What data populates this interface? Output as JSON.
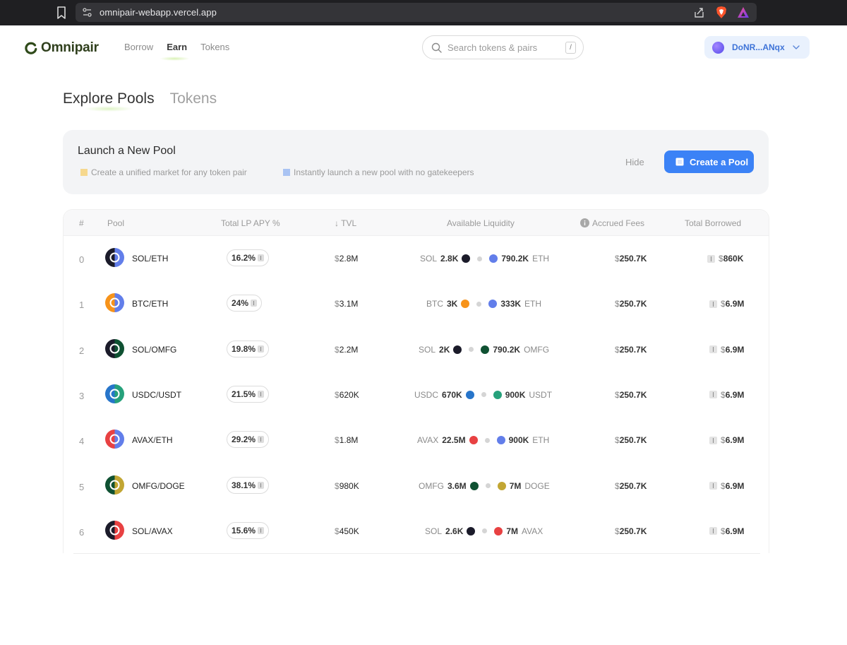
{
  "browser": {
    "url": "omnipair-webapp.vercel.app"
  },
  "header": {
    "logo_text": "Omnipair",
    "nav": [
      {
        "label": "Borrow",
        "active": false
      },
      {
        "label": "Earn",
        "active": true
      },
      {
        "label": "Tokens",
        "active": false
      }
    ],
    "search": {
      "placeholder": "Search tokens & pairs",
      "shortcut": "/"
    },
    "wallet": {
      "label": "DoNR...ANqx"
    }
  },
  "page_tabs": [
    {
      "label": "Explore Pools",
      "active": true
    },
    {
      "label": "Tokens",
      "active": false
    }
  ],
  "launch_card": {
    "title": "Launch a New Pool",
    "features": [
      {
        "text": "Create a unified market for any token pair",
        "color": "#f6d88e"
      },
      {
        "text": "Instantly launch a new pool with no gatekeepers",
        "color": "#a9c3f3"
      }
    ],
    "hide_label": "Hide",
    "create_label": "Create a Pool",
    "accent": "#3b82f6"
  },
  "table": {
    "headers": {
      "index": "#",
      "pool": "Pool",
      "apy": "Total LP APY %",
      "tvl": "TVL",
      "tvl_sort": "↓",
      "liquidity": "Available Liquidity",
      "fees": "Accrued Fees",
      "borrowed": "Total Borrowed"
    },
    "rows": [
      {
        "index": "0",
        "base": "SOL",
        "quote": "ETH",
        "apy": "16.2%",
        "tvl": "2.8M",
        "liq_base_sym": "SOL",
        "liq_base_val": "2.8K",
        "liq_quote_val": "790.2K",
        "liq_quote_sym": "ETH",
        "fees": "250.7K",
        "borrowed": "860K"
      },
      {
        "index": "1",
        "base": "BTC",
        "quote": "ETH",
        "apy": "24%",
        "tvl": "3.1M",
        "liq_base_sym": "BTC",
        "liq_base_val": "3K",
        "liq_quote_val": "333K",
        "liq_quote_sym": "ETH",
        "fees": "250.7K",
        "borrowed": "6.9M"
      },
      {
        "index": "2",
        "base": "SOL",
        "quote": "OMFG",
        "apy": "19.8%",
        "tvl": "2.2M",
        "liq_base_sym": "SOL",
        "liq_base_val": "2K",
        "liq_quote_val": "790.2K",
        "liq_quote_sym": "OMFG",
        "fees": "250.7K",
        "borrowed": "6.9M"
      },
      {
        "index": "3",
        "base": "USDC",
        "quote": "USDT",
        "apy": "21.5%",
        "tvl": "620K",
        "liq_base_sym": "USDC",
        "liq_base_val": "670K",
        "liq_quote_val": "900K",
        "liq_quote_sym": "USDT",
        "fees": "250.7K",
        "borrowed": "6.9M"
      },
      {
        "index": "4",
        "base": "AVAX",
        "quote": "ETH",
        "apy": "29.2%",
        "tvl": "1.8M",
        "liq_base_sym": "AVAX",
        "liq_base_val": "22.5M",
        "liq_quote_val": "900K",
        "liq_quote_sym": "ETH",
        "fees": "250.7K",
        "borrowed": "6.9M"
      },
      {
        "index": "5",
        "base": "OMFG",
        "quote": "DOGE",
        "apy": "38.1%",
        "tvl": "980K",
        "liq_base_sym": "OMFG",
        "liq_base_val": "3.6M",
        "liq_quote_val": "7M",
        "liq_quote_sym": "DOGE",
        "fees": "250.7K",
        "borrowed": "6.9M"
      },
      {
        "index": "6",
        "base": "SOL",
        "quote": "AVAX",
        "apy": "15.6%",
        "tvl": "450K",
        "liq_base_sym": "SOL",
        "liq_base_val": "2.6K",
        "liq_quote_val": "7M",
        "liq_quote_sym": "AVAX",
        "fees": "250.7K",
        "borrowed": "6.9M"
      }
    ]
  },
  "currency_symbol": "$",
  "token_colors": {
    "SOL": "#1b1b2a",
    "ETH": "#627eea",
    "BTC": "#f7931a",
    "OMFG": "#0f5132",
    "USDC": "#2775ca",
    "USDT": "#26a17b",
    "AVAX": "#e84142",
    "DOGE": "#c2a633"
  }
}
